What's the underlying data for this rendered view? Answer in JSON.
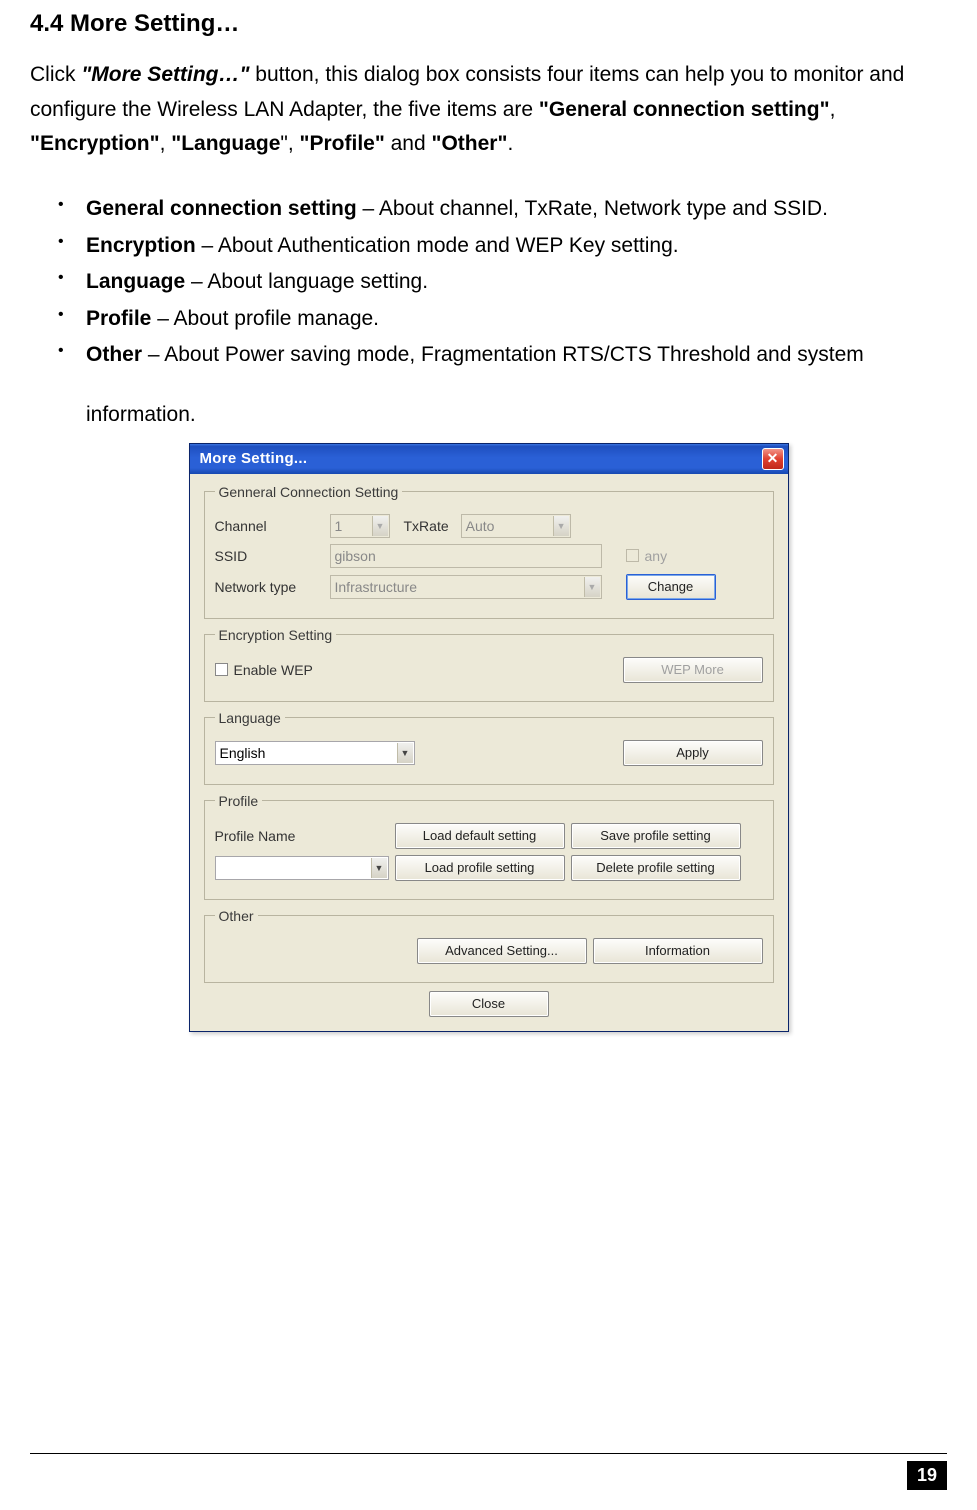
{
  "heading": "4.4  More Setting…",
  "intro": {
    "p1a": "Click ",
    "p1b": "\"More Setting…\"",
    "p1c": " button, this dialog box consists four items can help you to monitor and configure the Wireless LAN Adapter, the five items are ",
    "t1": "\"General connection setting\"",
    "sep1": ", ",
    "t2": "\"Encryption\"",
    "sep2": ", ",
    "t3": "\"Language",
    "sep3": "\", ",
    "t4": "\"Profile\"",
    "sep4": " and ",
    "t5": "\"Other\"",
    "end": "."
  },
  "bullets": {
    "b1_bold": "General connection setting",
    "b1_rest": " – About channel, TxRate, Network type and SSID.",
    "b2_bold": "Encryption",
    "b2_rest": " – About Authentication mode and WEP Key setting.",
    "b3_bold": "Language",
    "b3_rest": " – About language setting.",
    "b4_bold": "Profile",
    "b4_rest": " – About profile manage.",
    "b5_bold": "Other",
    "b5_rest": " – About Power saving mode, Fragmentation RTS/CTS Threshold and system",
    "b5_cont": "information."
  },
  "dialog": {
    "title": "More Setting...",
    "general": {
      "legend": "Genneral Connection Setting",
      "channel_label": "Channel",
      "channel_value": "1",
      "txrate_label": "TxRate",
      "txrate_value": "Auto",
      "ssid_label": "SSID",
      "ssid_value": "gibson",
      "any_label": "any",
      "nettype_label": "Network type",
      "nettype_value": "Infrastructure",
      "change_btn": "Change"
    },
    "encryption": {
      "legend": "Encryption Setting",
      "enable_wep": "Enable WEP",
      "wep_more": "WEP More"
    },
    "language": {
      "legend": "Language",
      "value": "English",
      "apply": "Apply"
    },
    "profile": {
      "legend": "Profile",
      "name_label": "Profile Name",
      "load_default": "Load default setting",
      "save": "Save profile setting",
      "load_profile": "Load profile setting",
      "delete": "Delete profile setting"
    },
    "other": {
      "legend": "Other",
      "advanced": "Advanced Setting...",
      "information": "Information"
    },
    "close": "Close"
  },
  "page_number": "19"
}
